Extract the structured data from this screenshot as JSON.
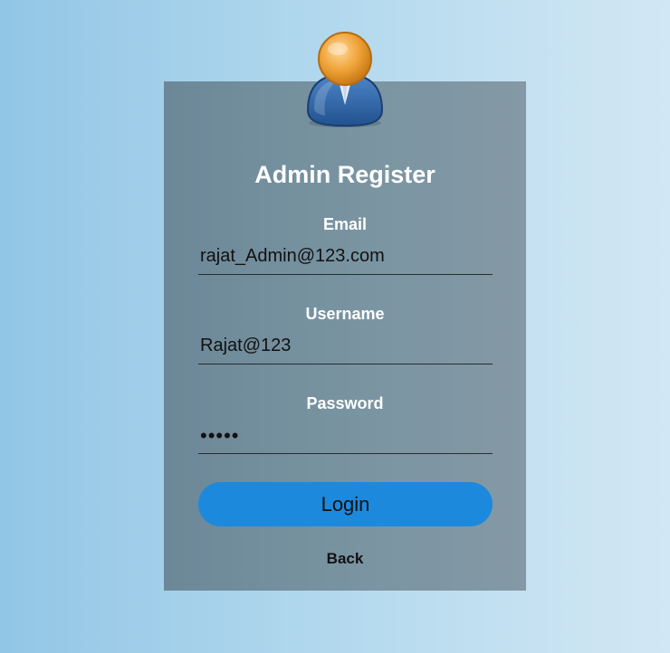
{
  "form": {
    "title": "Admin Register",
    "email": {
      "label": "Email",
      "value": "rajat_Admin@123.com"
    },
    "username": {
      "label": "Username",
      "value": "Rajat@123"
    },
    "password": {
      "label": "Password",
      "value": "12345"
    },
    "login_label": "Login",
    "back_label": "Back"
  },
  "icons": {
    "avatar": "admin-user-icon"
  },
  "colors": {
    "card_bg": "#7b95a2",
    "button": "#1d89dc",
    "avatar_head": "#f0a53a",
    "avatar_body": "#2f64a6"
  }
}
